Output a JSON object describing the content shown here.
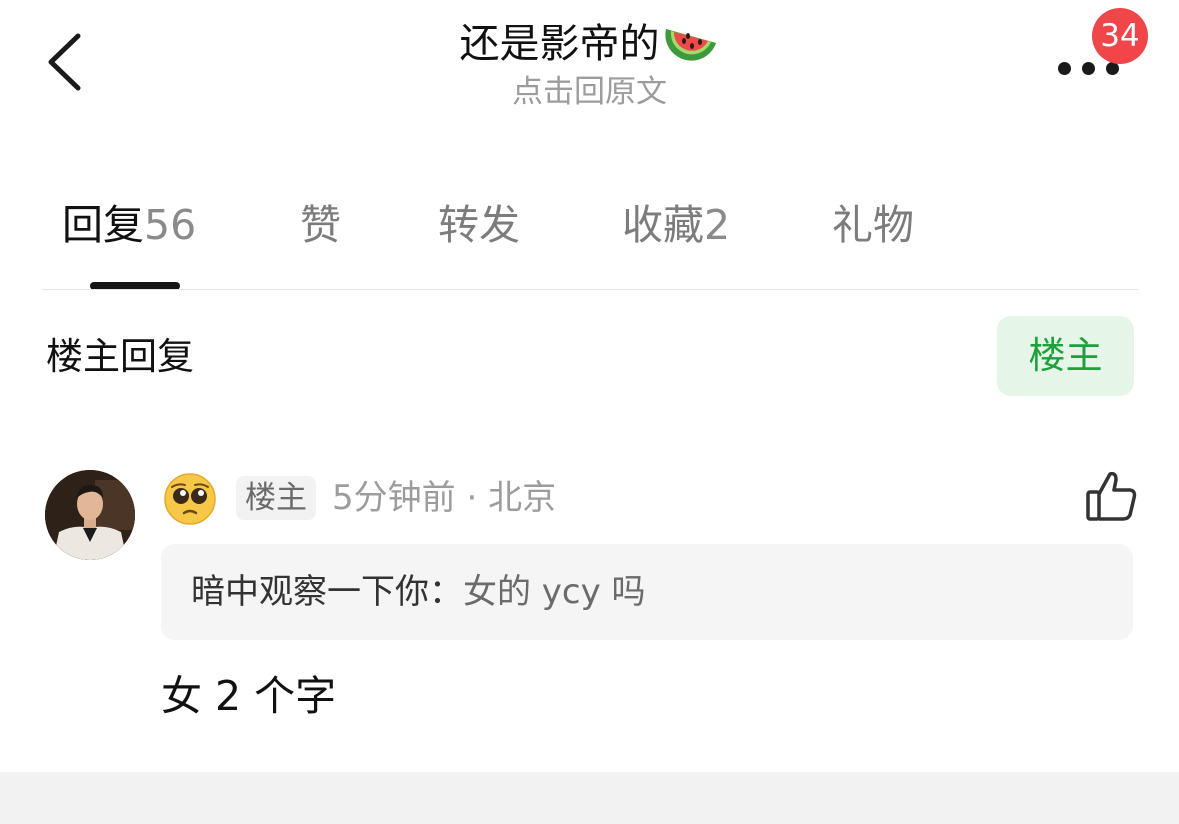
{
  "header": {
    "title": "还是影帝的",
    "title_emoji": "watermelon-emoji",
    "subtitle": "点击回原文",
    "notification_count": "34"
  },
  "tabs": [
    {
      "label": "回复",
      "count": "56",
      "active": true
    },
    {
      "label": "赞",
      "count": "",
      "active": false
    },
    {
      "label": "转发",
      "count": "",
      "active": false
    },
    {
      "label": "收藏",
      "count": "2",
      "active": false
    },
    {
      "label": "礼物",
      "count": "",
      "active": false
    }
  ],
  "section": {
    "title": "楼主回复",
    "filter_label": "楼主"
  },
  "comment": {
    "author_emoji": "pleading-face-emoji",
    "op_tag": "楼主",
    "time": "5分钟前",
    "location": "北京",
    "quote_author": "暗中观察一下你：",
    "quote_body": "女的 ycy 吗",
    "text": "女 2 个字"
  },
  "colors": {
    "accent_green": "#1ea03c",
    "chip_green_bg": "#e5f5e8",
    "badge_red": "#f0464a"
  }
}
